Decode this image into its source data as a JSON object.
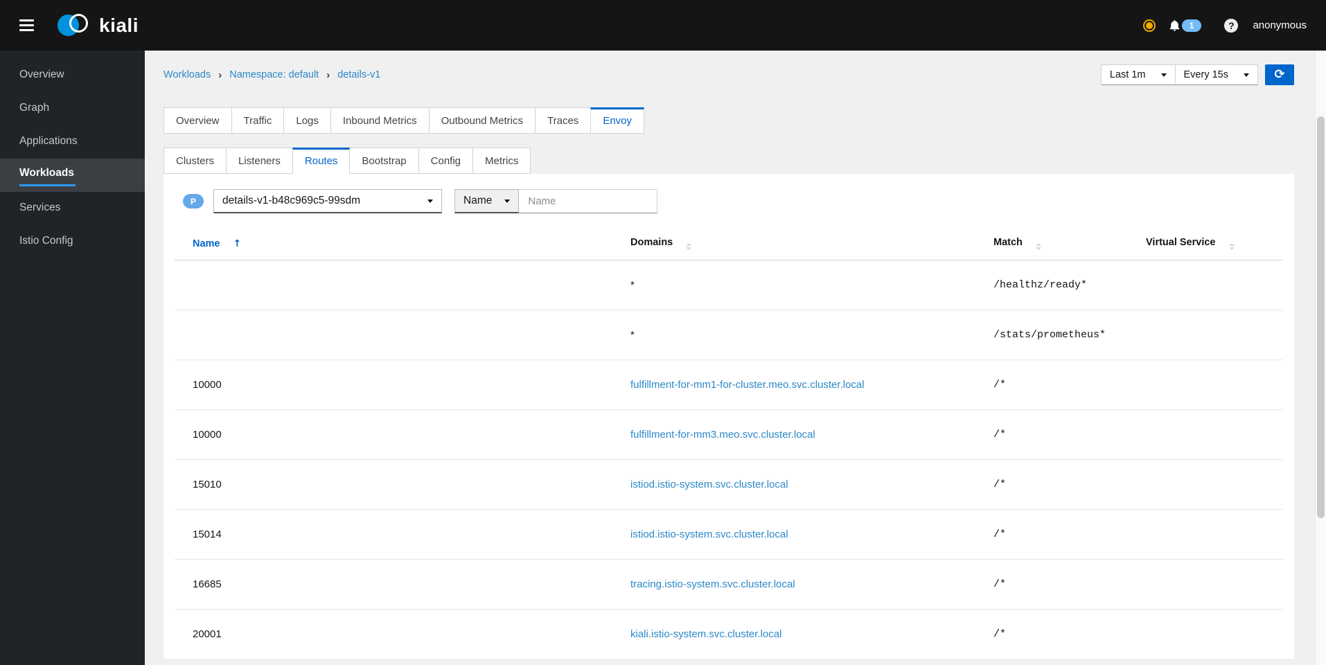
{
  "masthead": {
    "brand": "kiali",
    "notification_count": "1",
    "user": "anonymous"
  },
  "sidebar": {
    "items": [
      {
        "label": "Overview",
        "active": false
      },
      {
        "label": "Graph",
        "active": false
      },
      {
        "label": "Applications",
        "active": false
      },
      {
        "label": "Workloads",
        "active": true
      },
      {
        "label": "Services",
        "active": false
      },
      {
        "label": "Istio Config",
        "active": false
      }
    ]
  },
  "breadcrumb": {
    "items": [
      "Workloads",
      "Namespace: default",
      "details-v1"
    ]
  },
  "toolbar": {
    "duration": "Last 1m",
    "refresh_interval": "Every 15s"
  },
  "tabs": {
    "items": [
      {
        "label": "Overview",
        "active": false
      },
      {
        "label": "Traffic",
        "active": false
      },
      {
        "label": "Logs",
        "active": false
      },
      {
        "label": "Inbound Metrics",
        "active": false
      },
      {
        "label": "Outbound Metrics",
        "active": false
      },
      {
        "label": "Traces",
        "active": false
      },
      {
        "label": "Envoy",
        "active": true
      }
    ]
  },
  "subtabs": {
    "items": [
      {
        "label": "Clusters",
        "active": false
      },
      {
        "label": "Listeners",
        "active": false
      },
      {
        "label": "Routes",
        "active": true
      },
      {
        "label": "Bootstrap",
        "active": false
      },
      {
        "label": "Config",
        "active": false
      },
      {
        "label": "Metrics",
        "active": false
      }
    ]
  },
  "filters": {
    "pod_badge": "P",
    "pod": "details-v1-b48c969c5-99sdm",
    "filter_type": "Name",
    "filter_placeholder": "Name"
  },
  "table": {
    "columns": [
      "Name",
      "Domains",
      "Match",
      "Virtual Service"
    ],
    "sorted_column": "Name",
    "sort_direction": "ascending",
    "rows": [
      {
        "name": "",
        "domain": "*",
        "domain_link": false,
        "match": "/healthz/ready*",
        "virtual_service": ""
      },
      {
        "name": "",
        "domain": "*",
        "domain_link": false,
        "match": "/stats/prometheus*",
        "virtual_service": ""
      },
      {
        "name": "10000",
        "domain": "fulfillment-for-mm1-for-cluster.meo.svc.cluster.local",
        "domain_link": true,
        "match": "/*",
        "virtual_service": ""
      },
      {
        "name": "10000",
        "domain": "fulfillment-for-mm3.meo.svc.cluster.local",
        "domain_link": true,
        "match": "/*",
        "virtual_service": ""
      },
      {
        "name": "15010",
        "domain": "istiod.istio-system.svc.cluster.local",
        "domain_link": true,
        "match": "/*",
        "virtual_service": ""
      },
      {
        "name": "15014",
        "domain": "istiod.istio-system.svc.cluster.local",
        "domain_link": true,
        "match": "/*",
        "virtual_service": ""
      },
      {
        "name": "16685",
        "domain": "tracing.istio-system.svc.cluster.local",
        "domain_link": true,
        "match": "/*",
        "virtual_service": ""
      },
      {
        "name": "20001",
        "domain": "kiali.istio-system.svc.cluster.local",
        "domain_link": true,
        "match": "/*",
        "virtual_service": ""
      }
    ]
  },
  "colors": {
    "accent": "#0066cc",
    "link": "#2b88c8",
    "masthead_bg": "#151515",
    "sidebar_bg": "#212427",
    "sidebar_active_bg": "#3b3e42",
    "active_underline": "#2b9af3",
    "warning_dot": "#f0ab00",
    "notification_badge": "#73bcf7",
    "pod_badge": "#65a8e8"
  }
}
